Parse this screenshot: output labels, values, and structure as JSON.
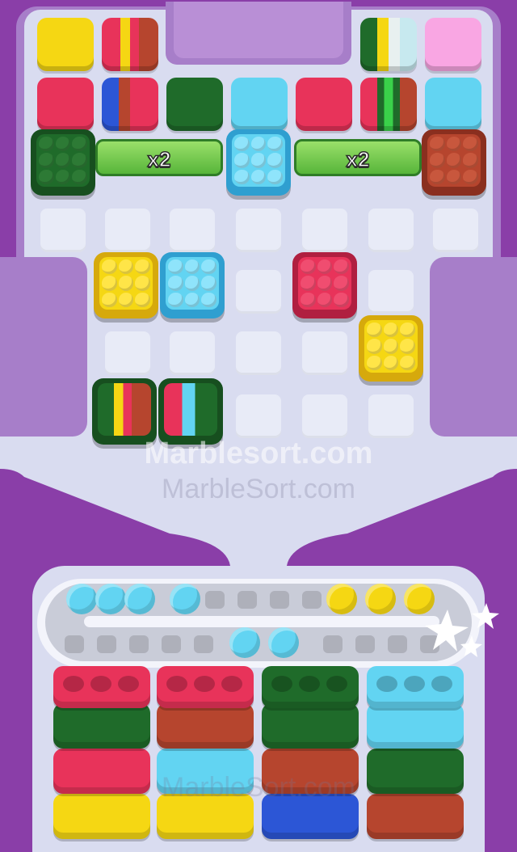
{
  "game": {
    "multiplier_left": "x2",
    "multiplier_right": "x2",
    "watermark_top": "Marblesort.com",
    "watermark_mid": "MarbleSort.com",
    "watermark_bottom": "MarbleSort.com"
  },
  "colors": {
    "yellow": "#f5d713",
    "pink": "#e8335a",
    "green": "#1f6b2a",
    "cyan": "#62d4f2",
    "brown": "#b6452e",
    "blue": "#2c56d6",
    "lightpink": "#f9a6e3",
    "lavender": "#a98ad2",
    "slot": "#e8ebf7",
    "board": "#d7dbef"
  },
  "queue_tiles": {
    "row1": [
      "yellow",
      "striped-red-yellow-brown",
      "",
      "",
      "",
      "striped-green-yellow-white",
      "lightpink"
    ],
    "row2": [
      "pink",
      "striped-blue-brown-pink",
      "green",
      "cyan",
      "pink",
      "striped-brown-green-pink",
      "cyan"
    ]
  },
  "track_balls": {
    "top_row": [
      "cyan",
      "cyan",
      "cyan",
      "cyan",
      "yellow",
      "yellow",
      "yellow"
    ],
    "bottom_row": [
      "cyan",
      "cyan"
    ]
  },
  "stacks": [
    {
      "cap": "pink",
      "layers": [
        "green",
        "pink",
        "yellow"
      ]
    },
    {
      "cap": "pink",
      "layers": [
        "brown",
        "cyan",
        "yellow"
      ]
    },
    {
      "cap": "green",
      "layers": [
        "green",
        "brown",
        "blue"
      ]
    },
    {
      "cap": "cyan",
      "layers": [
        "cyan",
        "green",
        "brown"
      ]
    }
  ]
}
